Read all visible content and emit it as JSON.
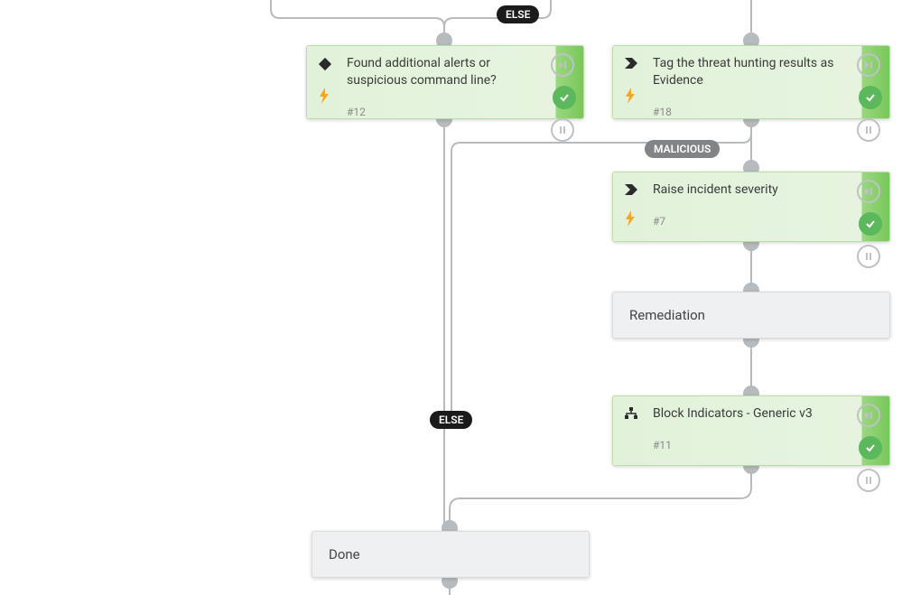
{
  "labels": {
    "else1": "ELSE",
    "else2": "ELSE",
    "malicious": "MALICIOUS"
  },
  "nodes": {
    "n12": {
      "title": "Found additional alerts or suspicious command line?",
      "tag": "#12",
      "icon": "diamond"
    },
    "n18": {
      "title": "Tag the threat hunting results as Evidence",
      "tag": "#18",
      "icon": "chevron"
    },
    "n7": {
      "title": "Raise incident severity",
      "tag": "#7",
      "icon": "chevron"
    },
    "rem": {
      "title": "Remediation"
    },
    "n11": {
      "title": "Block Indicators - Generic v3",
      "tag": "#11",
      "icon": "tree"
    },
    "done": {
      "title": "Done"
    }
  }
}
